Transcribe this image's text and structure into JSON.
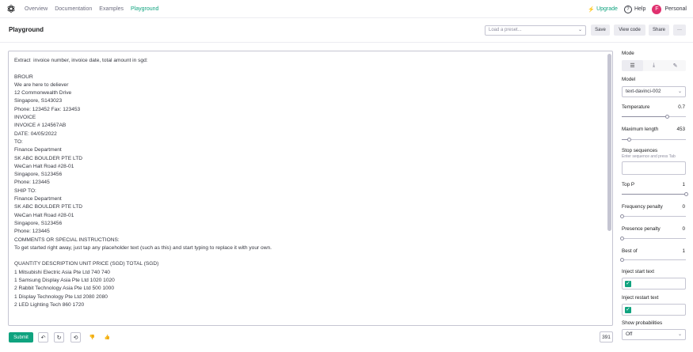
{
  "nav": {
    "links": [
      "Overview",
      "Documentation",
      "Examples",
      "Playground"
    ],
    "upgrade": "Upgrade",
    "help": "Help",
    "help_glyph": "?",
    "personal": "Personal",
    "avatar_letter": "F"
  },
  "header": {
    "title": "Playground",
    "preset_placeholder": "Load a preset...",
    "save": "Save",
    "view_code": "View code",
    "share": "Share",
    "more": "···"
  },
  "editor": {
    "lines": [
      "Extract  invoice number, invoice date, total amount in sgd:",
      "",
      "BROUR",
      "We are here to deliever",
      "12 Commonwealth Drive",
      "Singapore, S143023",
      "Phone: 123452 Fax: 123453",
      "INVOICE",
      "INVOICE # 124567AB",
      "DATE: 04/05/2022",
      "TO:",
      "Finance Department",
      "SK ABC BOULDER PTE LTD",
      "WeCan Halt Road #28-01",
      "Singapore, S123456",
      "Phone: 123445",
      "SHIP TO:",
      "Finance Department",
      "SK ABC BOULDER PTE LTD",
      "WeCan Halt Road #28-01",
      "Singapore, S123456",
      "Phone: 123445",
      "COMMENTS OR SPECIAL INSTRUCTIONS:",
      "To get started right away, just tap any placeholder text (such as this) and start typing to replace it with your own.",
      "",
      "QUANTITY DESCRIPTION UNIT PRICE (SGD) TOTAL (SGD)",
      "1 Mitsubishi Electric Asia Pte Ltd 740 740",
      "1 Samsung Display Asia Pte Ltd 1020 1020",
      "2 Rabbit Technology Asia Pte Ltd 500 1000",
      "1 Display Technology Pte Ltd 2080 2080",
      "2 LED Lighting Tech 860 1720"
    ],
    "token_count": "391"
  },
  "bottom": {
    "submit": "Submit",
    "undo_glyph": "↶",
    "regen_glyph": "↻",
    "history_glyph": "⟲",
    "thumbs_down_glyph": "👎",
    "thumbs_up_glyph": "👍"
  },
  "panel": {
    "mode_label": "Mode",
    "mode_icons": [
      "complete-icon",
      "insert-icon",
      "edit-icon"
    ],
    "mode_active": 0,
    "model_label": "Model",
    "model_value": "text-davinci-002",
    "temperature_label": "Temperature",
    "temperature_value": "0.7",
    "temperature_fraction": 0.7,
    "max_length_label": "Maximum length",
    "max_length_value": "453",
    "max_length_fraction": 0.11,
    "stop_label": "Stop sequences",
    "stop_help": "Enter sequence and press Tab",
    "top_p_label": "Top P",
    "top_p_value": "1",
    "top_p_fraction": 1.0,
    "freq_label": "Frequency penalty",
    "freq_value": "0",
    "freq_fraction": 0.0,
    "presence_label": "Presence penalty",
    "presence_value": "0",
    "presence_fraction": 0.0,
    "best_of_label": "Best of",
    "best_of_value": "1",
    "best_of_fraction": 0.0,
    "inject_start_label": "Inject start text",
    "inject_start_checked": true,
    "inject_restart_label": "Inject restart text",
    "inject_restart_checked": true,
    "show_prob_label": "Show probabilities",
    "show_prob_value": "Off"
  },
  "colors": {
    "accent": "#10a37f",
    "avatar": "#e0306f"
  }
}
